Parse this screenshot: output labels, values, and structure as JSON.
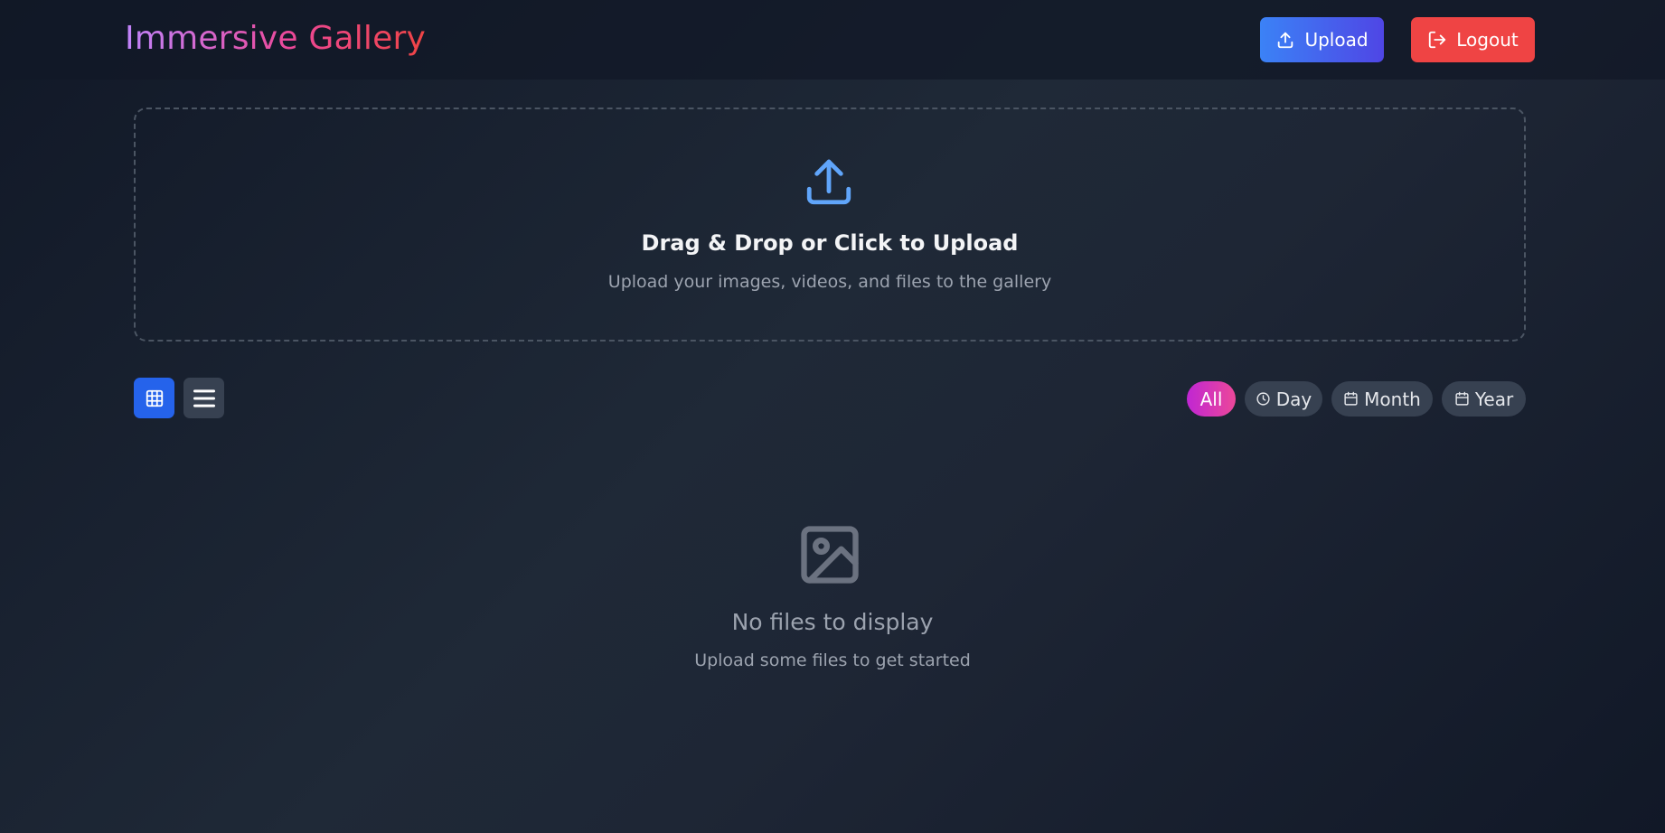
{
  "header": {
    "brand": "Immersive Gallery",
    "upload_label": "Upload",
    "logout_label": "Logout"
  },
  "dropzone": {
    "title": "Drag & Drop or Click to Upload",
    "subtitle": "Upload your images, videos, and files to the gallery",
    "icon": "upload-icon"
  },
  "view_toggle": {
    "active": "grid",
    "options": [
      "grid-view-icon",
      "list-view-icon"
    ]
  },
  "filters": {
    "active": "All",
    "items": [
      {
        "label": "All",
        "icon": ""
      },
      {
        "label": "Day",
        "icon": "clock-icon"
      },
      {
        "label": "Month",
        "icon": "calendar-icon"
      },
      {
        "label": "Year",
        "icon": "calendar-icon"
      }
    ]
  },
  "empty_state": {
    "icon": "image-icon",
    "title": "No files to display",
    "subtitle": "Upload some files to get started"
  },
  "colors": {
    "background": "#1f2937",
    "upload_button": "#3b82f6",
    "logout_button": "#ef4444",
    "active_view": "#2563eb",
    "active_filter": "#d946ef",
    "accent_icon": "#60a5fa"
  }
}
